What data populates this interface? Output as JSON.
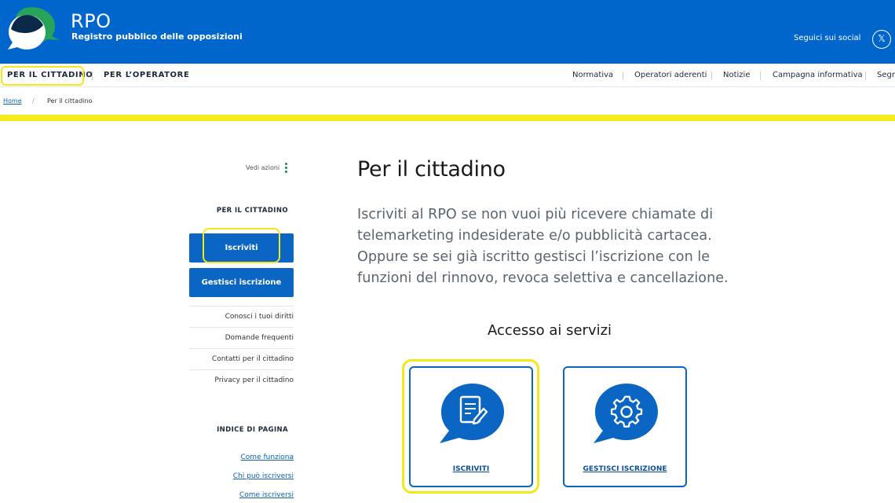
{
  "header": {
    "brand_title": "RPO",
    "brand_subtitle": "Registro pubblico delle opposizioni",
    "social_label": "Seguici sui social",
    "x_icon": "x-social-icon"
  },
  "nav": {
    "left": [
      "PER IL CITTADINO",
      "PER L’OPERATORE"
    ],
    "right": [
      "Normativa",
      "Operatori aderenti",
      "Notizie",
      "Campagna informativa",
      "Segn"
    ]
  },
  "breadcrumb": {
    "home": "Home",
    "separator": "/",
    "current": "Per il cittadino"
  },
  "sidebar": {
    "actions_label": "Vedi azioni",
    "section_title": "PER IL CITTADINO",
    "buttons": [
      "Iscriviti",
      "Gestisci iscrizione"
    ],
    "links": [
      "Conosci i tuoi diritti",
      "Domande frequenti",
      "Contatti per il cittadino",
      "Privacy per il cittadino"
    ],
    "toc_title": "INDICE DI PAGINA",
    "toc_links": [
      "Come funziona",
      "Chi può iscriversi",
      "Come iscriversi"
    ]
  },
  "main": {
    "title": "Per il cittadino",
    "intro": "Iscriviti al RPO se non vuoi più ricevere chiamate di telemarketing indesiderate e/o pubblicità cartacea. Oppure se sei già iscritto gestisci l’iscrizione con le funzioni del rinnovo, revoca selettiva e cancellazione.",
    "services_title": "Accesso ai servizi",
    "cards": [
      {
        "label": "ISCRIVITI",
        "icon": "document-edit-icon"
      },
      {
        "label": "GESTISCI ISCRIZIONE",
        "icon": "gear-icon"
      }
    ]
  },
  "colors": {
    "header_blue": "#0066cc",
    "button_blue": "#0a66c2",
    "highlight_yellow": "#f2e81a",
    "accent_green": "#1c8a4b"
  }
}
